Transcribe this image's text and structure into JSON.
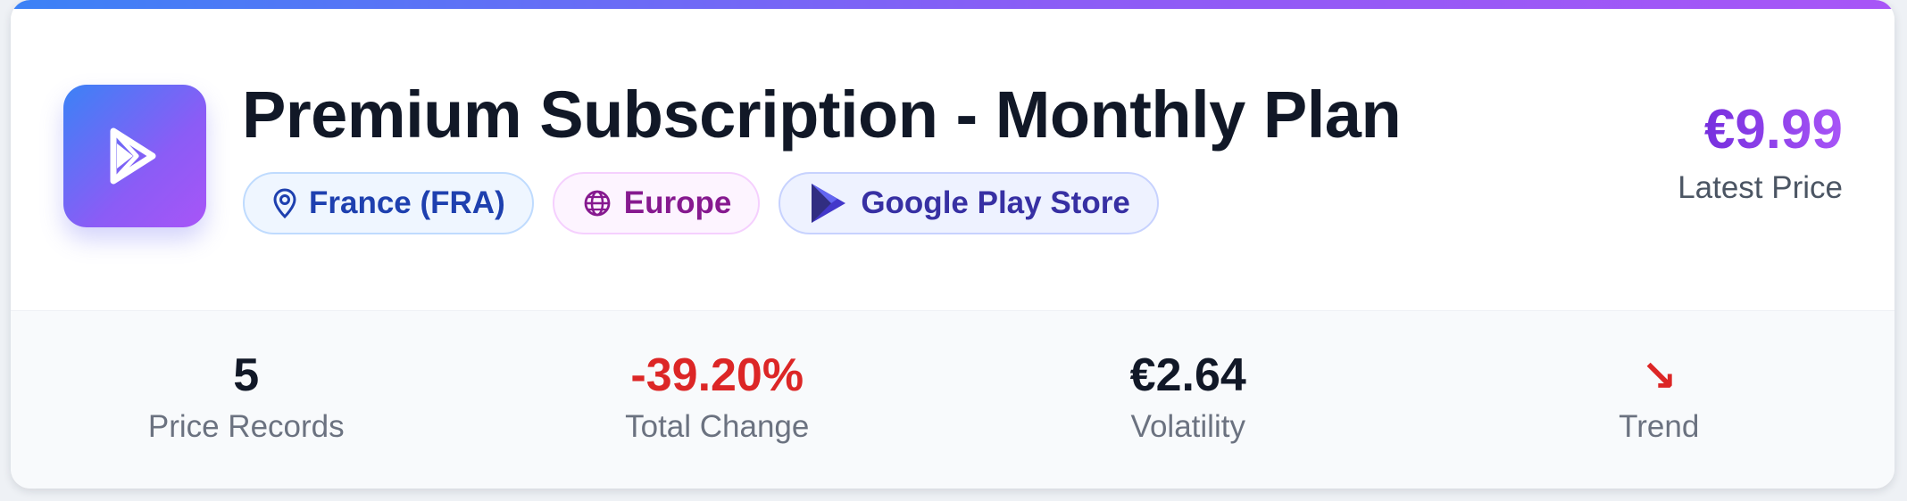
{
  "product": {
    "title": "Premium Subscription - Monthly Plan",
    "icon": "play-store-icon"
  },
  "badges": {
    "country": {
      "label": "France (FRA)",
      "icon": "location-pin-icon",
      "color": "#1e40af"
    },
    "region": {
      "label": "Europe",
      "icon": "globe-icon",
      "color": "#86198f"
    },
    "store": {
      "label": "Google Play Store",
      "icon": "google-play-icon",
      "color": "#3730a3"
    }
  },
  "price": {
    "value": "€9.99",
    "label": "Latest Price"
  },
  "stats": {
    "records": {
      "value": "5",
      "label": "Price Records"
    },
    "change": {
      "value": "-39.20%",
      "label": "Total Change",
      "color": "#dc2626"
    },
    "volatility": {
      "value": "€2.64",
      "label": "Volatility"
    },
    "trend": {
      "value": "↘",
      "label": "Trend",
      "direction": "down",
      "color": "#dc2626"
    }
  },
  "colors": {
    "accent_start": "#3b82f6",
    "accent_end": "#a855f7",
    "negative": "#dc2626"
  }
}
